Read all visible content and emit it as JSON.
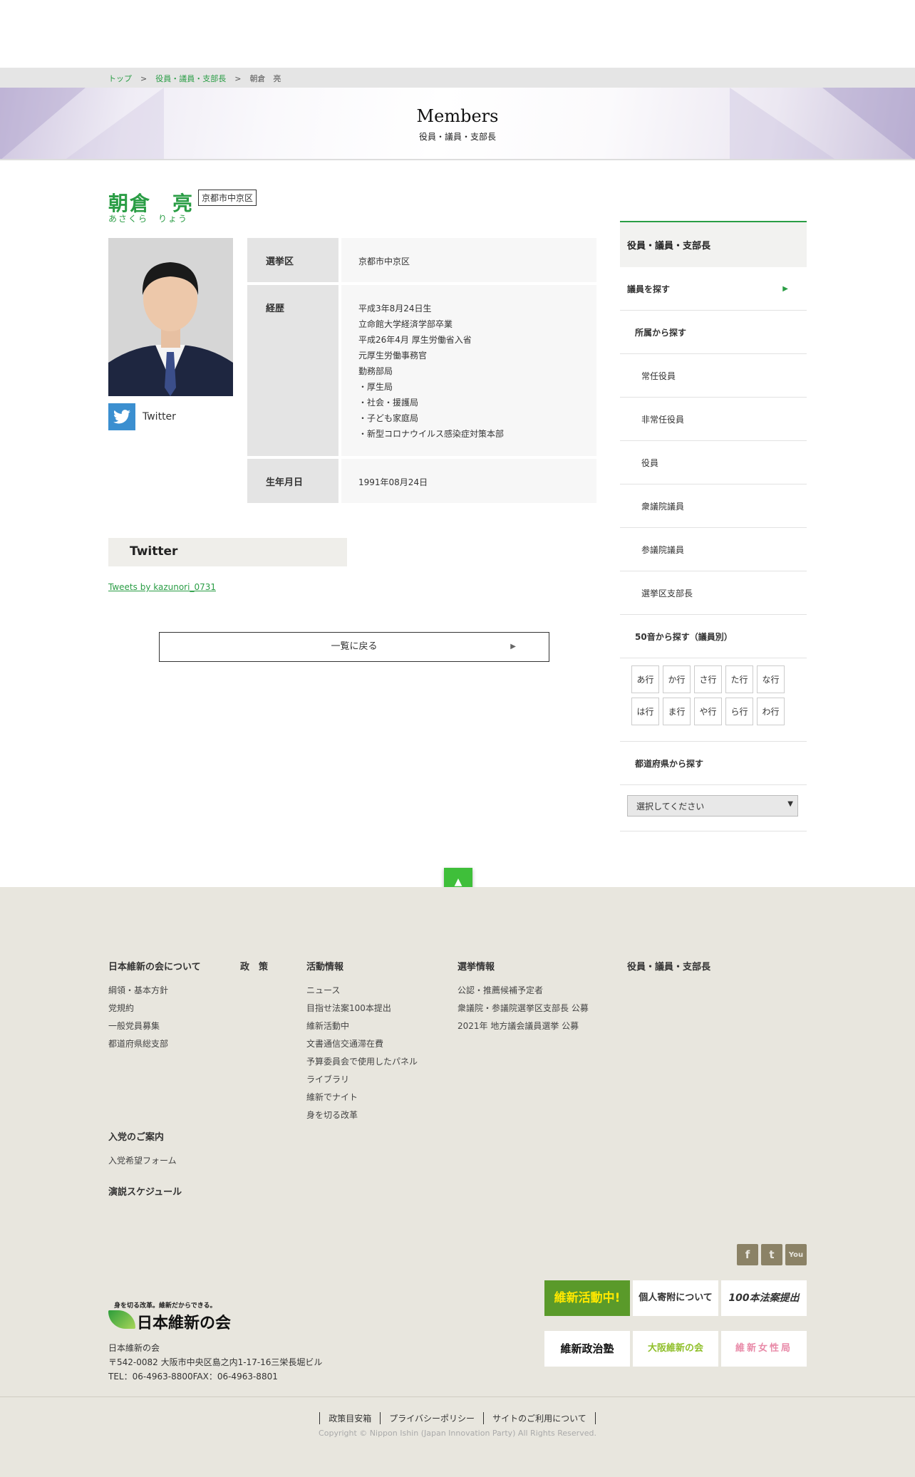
{
  "breadcrumb": {
    "home": "トップ",
    "section": "役員・議員・支部長",
    "current": "朝倉　亮",
    "sep": ">"
  },
  "hero": {
    "title": "Members",
    "subtitle": "役員・議員・支部長"
  },
  "member": {
    "name": "朝倉　亮",
    "kana": "あさくら　りょう",
    "district_badge": "京都市中京区",
    "twitter_label": "Twitter",
    "profile": {
      "district_label": "選挙区",
      "district_value": "京都市中京区",
      "career_label": "経歴",
      "career_lines": [
        "平成3年8月24日生",
        "立命館大学経済学部卒業",
        "平成26年4月 厚生労働省入省",
        "元厚生労働事務官",
        "勤務部局",
        "・厚生局",
        "・社会・援護局",
        "・子ども家庭局",
        "・新型コロナウイルス感染症対策本部"
      ],
      "birthday_label": "生年月日",
      "birthday_value": "1991年08月24日"
    }
  },
  "twitter_section": {
    "heading": "Twitter",
    "link": "Tweets by kazunori_0731"
  },
  "back_button": {
    "label": "一覧に戻る"
  },
  "sidebar": {
    "heading": "役員・議員・支部長",
    "find_members": "議員を探す",
    "by_affiliation": "所属から探す",
    "affiliation_items": [
      "常任役員",
      "非常任役員",
      "役員",
      "衆議院議員",
      "参議院議員",
      "選挙区支部長"
    ],
    "by_kana": "50音から探す（議員別）",
    "kana_rows": [
      [
        "あ行",
        "か行",
        "さ行",
        "た行",
        "な行"
      ],
      [
        "は行",
        "ま行",
        "や行",
        "ら行",
        "わ行"
      ]
    ],
    "by_prefecture": "都道府県から探す",
    "select_value": "選択してください"
  },
  "footer": {
    "columns": {
      "about": {
        "title": "日本維新の会について",
        "links": [
          "綱領・基本方針",
          "党規約",
          "一般党員募集",
          "都道府県総支部"
        ]
      },
      "policy": {
        "title": "政　策"
      },
      "activity": {
        "title": "活動情報",
        "links": [
          "ニュース",
          "目指せ法案100本提出",
          "維新活動中",
          "文書通信交通滞在費",
          "予算委員会で使用したパネル",
          "ライブラリ",
          "維新でナイト",
          "身を切る改革"
        ]
      },
      "election": {
        "title": "選挙情報",
        "links": [
          "公認・推薦候補予定者",
          "衆議院・参議院選挙区支部長 公募",
          "2021年 地方議会議員選挙 公募"
        ]
      },
      "members": {
        "title": "役員・議員・支部長"
      },
      "join": {
        "title": "入党のご案内",
        "links": [
          "入党希望フォーム"
        ]
      },
      "speech": {
        "title": "演説スケジュール"
      }
    },
    "social": [
      "f",
      "t",
      "You"
    ],
    "banners": [
      {
        "text": "維新活動中!",
        "bg": "#5a9a2a",
        "fg": "#ffe800"
      },
      {
        "text": "個人寄附について",
        "bg": "#ffffff",
        "fg": "#333333"
      },
      {
        "text": "100本法案提出",
        "bg": "#ffffff",
        "fg": "#333333"
      },
      {
        "text": "維新政治塾",
        "bg": "#ffffff",
        "fg": "#111111"
      },
      {
        "text": "大阪維新の会",
        "bg": "#ffffff",
        "fg": "#8fbf2a"
      },
      {
        "text": "維新女性局",
        "bg": "#ffffff",
        "fg": "#e88aa8"
      }
    ],
    "logo": {
      "tagline": "身を切る改革。維新だからできる。",
      "wordmark": "日本維新の会"
    },
    "address": {
      "org": "日本維新の会",
      "line": "〒542-0082 大阪市中央区島之内1-17-16三栄長堀ビル",
      "tel": "TEL：06-4963-8800FAX：06-4963-8801"
    },
    "nav": [
      "政策目安箱",
      "プライバシーポリシー",
      "サイトのご利用について"
    ],
    "copyright": "Copyright © Nippon Ishin (Japan Innovation Party) All Rights Reserved."
  },
  "colors": {
    "accent": "#2a9d45",
    "footer_bg": "#e8e6de",
    "pagetop": "#3fbf3a"
  }
}
